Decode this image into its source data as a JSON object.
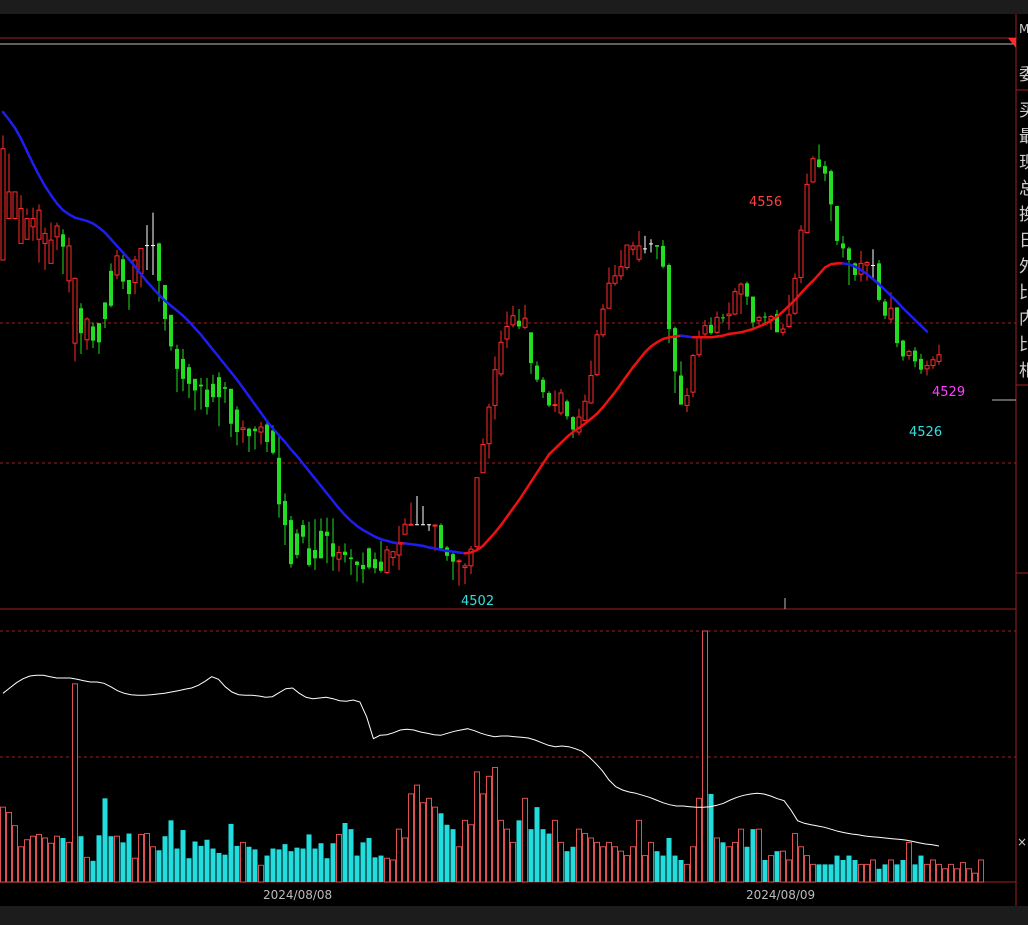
{
  "colors": {
    "background": "#000000",
    "up": "#ff2a2a",
    "down": "#22dd22",
    "flat": "#ffffff",
    "ma_down": "#1e1ef0",
    "ma_up": "#ee1111",
    "vol_up": "#e05050",
    "vol_down": "#22dddd",
    "grid": "#a02020",
    "price_high": "#ff4040",
    "price_low": "#30e0e0",
    "price_last": "#ff40ff"
  },
  "right_panel": {
    "top_marker": "M",
    "labels": [
      "委",
      "买",
      "最",
      "现",
      "总",
      "换",
      "日",
      "外",
      "比",
      "内",
      "比",
      "相"
    ],
    "bottom_marker": "×"
  },
  "chart_data": {
    "type": "candlestick",
    "price_ylim": [
      4498,
      4566
    ],
    "annotations": {
      "high": "4556",
      "low": "4502",
      "last": "4529",
      "last_low": "4526"
    },
    "x_labels": [
      "2024/08/08",
      "2024/08/09"
    ],
    "candles": [
      [
        4540.0,
        4553.4,
        4555.0,
        4541.5
      ],
      [
        4545.0,
        4548.2,
        4552.8,
        4546.7
      ],
      [
        4545.0,
        4548.2,
        4547.3,
        4544.9
      ],
      [
        4542.0,
        4546.2,
        4547.8,
        4543.8
      ],
      [
        4542.5,
        4545.0,
        4546.2,
        4545.4
      ],
      [
        4544.0,
        4545.0,
        4546.3,
        4542.3
      ],
      [
        4542.5,
        4546.0,
        4546.7,
        4539.7
      ],
      [
        4542.0,
        4543.2,
        4543.9,
        4538.8
      ],
      [
        4539.6,
        4542.4,
        4544.5,
        4540.4
      ],
      [
        4542.8,
        4544.1,
        4544.5,
        4541.2
      ],
      [
        4543.1,
        4541.6,
        4543.7,
        4538.3
      ],
      [
        4537.5,
        4541.7,
        4542.7,
        4536.1
      ],
      [
        4530.0,
        4537.8,
        4537.9,
        4527.8
      ],
      [
        4534.2,
        4531.2,
        4534.8,
        4528.7
      ],
      [
        4530.4,
        4532.9,
        4533.1,
        4529.2
      ],
      [
        4532.0,
        4530.3,
        4532.5,
        4529.4
      ],
      [
        4532.4,
        4530.1,
        4532.4,
        4528.7
      ],
      [
        4534.9,
        4532.9,
        4534.9,
        4531.8
      ],
      [
        4538.7,
        4534.5,
        4539.6,
        4534.3
      ],
      [
        4538.2,
        4540.5,
        4541.2,
        4537.7
      ],
      [
        4540.1,
        4537.4,
        4540.6,
        4536.5
      ],
      [
        4537.6,
        4535.9,
        4537.6,
        4534.0
      ],
      [
        4537.3,
        4540.0,
        4540.5,
        4535.9
      ],
      [
        4538.4,
        4541.4,
        4541.4,
        4536.7
      ],
      [
        4541.8,
        4541.8,
        4544.2,
        4538.8
      ],
      [
        4541.8,
        4541.8,
        4545.7,
        4538.2
      ],
      [
        4542.0,
        4537.5,
        4542.1,
        4535.0
      ],
      [
        4537.0,
        4532.9,
        4537.0,
        4531.5
      ],
      [
        4533.4,
        4529.6,
        4533.4,
        4529.1
      ],
      [
        4529.3,
        4526.9,
        4529.8,
        4524.1
      ],
      [
        4528.1,
        4525.7,
        4529.3,
        4524.2
      ],
      [
        4527.1,
        4525.1,
        4527.5,
        4523.4
      ],
      [
        4525.7,
        4524.3,
        4525.7,
        4521.9
      ],
      [
        4525.0,
        4524.8,
        4525.8,
        4522.0
      ],
      [
        4524.4,
        4522.3,
        4525.8,
        4521.4
      ],
      [
        4525.1,
        4523.5,
        4526.2,
        4522.9
      ],
      [
        4525.9,
        4523.5,
        4526.5,
        4520.0
      ],
      [
        4524.7,
        4524.5,
        4525.3,
        4522.8
      ],
      [
        4524.5,
        4520.3,
        4524.5,
        4518.7
      ],
      [
        4522.0,
        4519.3,
        4522.4,
        4517.7
      ],
      [
        4519.6,
        4519.8,
        4520.7,
        4518.0
      ],
      [
        4519.7,
        4518.8,
        4519.8,
        4516.9
      ],
      [
        4519.7,
        4519.4,
        4520.0,
        4517.2
      ],
      [
        4519.3,
        4519.9,
        4520.5,
        4517.8
      ],
      [
        4520.2,
        4518.1,
        4520.6,
        4516.9
      ],
      [
        4519.5,
        4516.8,
        4520.1,
        4516.6
      ],
      [
        4516.2,
        4510.6,
        4519.0,
        4509.0
      ],
      [
        4511.0,
        4508.1,
        4511.9,
        4505.7
      ],
      [
        4508.7,
        4503.4,
        4509.2,
        4503.0
      ],
      [
        4507.1,
        4504.5,
        4507.6,
        4504.1
      ],
      [
        4508.1,
        4506.7,
        4508.7,
        4505.9
      ],
      [
        4505.3,
        4503.3,
        4508.5,
        4503.1
      ],
      [
        4505.1,
        4504.1,
        4508.8,
        4502.7
      ],
      [
        4507.4,
        4504.1,
        4508.9,
        4504.1
      ],
      [
        4507.3,
        4506.8,
        4509.0,
        4503.5
      ],
      [
        4505.9,
        4504.3,
        4508.9,
        4502.6
      ],
      [
        4504.0,
        4504.8,
        4505.6,
        4502.5
      ],
      [
        4504.9,
        4504.5,
        4505.9,
        4503.6
      ],
      [
        4504.2,
        4504.0,
        4505.2,
        4502.1
      ],
      [
        4503.7,
        4503.3,
        4503.8,
        4501.3
      ],
      [
        4503.3,
        4502.8,
        4504.8,
        4501.1
      ],
      [
        4505.3,
        4503.0,
        4505.4,
        4502.8
      ],
      [
        4504.0,
        4502.9,
        4504.8,
        4502.3
      ],
      [
        4503.7,
        4502.6,
        4506.2,
        4502.4
      ],
      [
        4502.4,
        4505.1,
        4505.6,
        4502.2
      ],
      [
        4504.2,
        4504.9,
        4505.0,
        4503.2
      ],
      [
        4504.5,
        4506.0,
        4508.0,
        4502.7
      ],
      [
        4507.0,
        4508.2,
        4508.9,
        4507.0
      ],
      [
        4508.1,
        4508.2,
        4510.8,
        4508.1
      ],
      [
        4508.2,
        4508.2,
        4511.6,
        4508.2
      ],
      [
        4508.2,
        4508.2,
        4510.4,
        4508.1
      ],
      [
        4508.2,
        4508.2,
        4508.2,
        4507.4
      ],
      [
        4508.0,
        4508.1,
        4508.2,
        4505.0
      ],
      [
        4508.1,
        4505.3,
        4508.3,
        4505.3
      ],
      [
        4505.4,
        4504.4,
        4505.6,
        4503.8
      ],
      [
        4504.6,
        4503.7,
        4504.9,
        4501.5
      ],
      [
        4503.7,
        4503.8,
        4504.0,
        4500.8
      ],
      [
        4503.0,
        4503.2,
        4503.5,
        4501.0
      ],
      [
        4503.2,
        4505.2,
        4505.6,
        4502.2
      ],
      [
        4505.5,
        4513.8,
        4513.8,
        4504.9
      ],
      [
        4514.4,
        4517.8,
        4518.5,
        4514.4
      ],
      [
        4517.9,
        4522.3,
        4522.7,
        4516.1
      ],
      [
        4522.5,
        4526.8,
        4528.4,
        4520.8
      ],
      [
        4526.3,
        4530.1,
        4531.5,
        4526.0
      ],
      [
        4530.5,
        4532.0,
        4533.8,
        4529.4
      ],
      [
        4532.2,
        4533.3,
        4534.5,
        4531.9
      ],
      [
        4532.7,
        4532.0,
        4534.1,
        4531.7
      ],
      [
        4531.9,
        4533.0,
        4534.6,
        4531.7
      ],
      [
        4531.3,
        4527.6,
        4531.3,
        4526.3
      ],
      [
        4527.3,
        4525.6,
        4527.8,
        4525.3
      ],
      [
        4525.6,
        4524.1,
        4525.9,
        4523.4
      ],
      [
        4524.0,
        4522.5,
        4524.2,
        4522.3
      ],
      [
        4522.5,
        4522.6,
        4524.3,
        4521.7
      ],
      [
        4521.6,
        4524.0,
        4524.5,
        4521.3
      ],
      [
        4523.0,
        4521.2,
        4523.2,
        4520.8
      ],
      [
        4521.1,
        4519.6,
        4521.2,
        4518.6
      ],
      [
        4519.3,
        4521.1,
        4522.1,
        4518.9
      ],
      [
        4520.7,
        4523.0,
        4523.8,
        4520.6
      ],
      [
        4522.8,
        4526.1,
        4527.9,
        4522.7
      ],
      [
        4526.2,
        4531.0,
        4531.6,
        4526.0
      ],
      [
        4531.0,
        4534.1,
        4534.7,
        4530.7
      ],
      [
        4534.2,
        4537.2,
        4539.1,
        4534.2
      ],
      [
        4537.2,
        4538.1,
        4539.4,
        4536.9
      ],
      [
        4538.1,
        4539.2,
        4541.2,
        4537.6
      ],
      [
        4539.1,
        4541.8,
        4541.8,
        4538.8
      ],
      [
        4541.3,
        4541.7,
        4542.2,
        4540.6
      ],
      [
        4540.1,
        4541.7,
        4543.5,
        4539.8
      ],
      [
        4541.4,
        4541.4,
        4542.9,
        4540.8
      ],
      [
        4542.0,
        4542.0,
        4542.5,
        4540.9
      ],
      [
        4541.8,
        4541.6,
        4541.8,
        4540.1
      ],
      [
        4541.7,
        4539.2,
        4542.4,
        4539.0
      ],
      [
        4539.4,
        4531.7,
        4539.6,
        4530.0
      ],
      [
        4531.8,
        4526.6,
        4532.0,
        4524.0
      ],
      [
        4526.1,
        4522.6,
        4527.8,
        4522.6
      ],
      [
        4522.5,
        4523.7,
        4524.6,
        4521.7
      ],
      [
        4524.1,
        4528.5,
        4528.7,
        4523.5
      ],
      [
        4528.6,
        4530.8,
        4531.5,
        4528.3
      ],
      [
        4531.1,
        4532.1,
        4532.8,
        4530.6
      ],
      [
        4532.2,
        4531.2,
        4533.1,
        4531.0
      ],
      [
        4531.3,
        4533.1,
        4533.8,
        4531.1
      ],
      [
        4533.1,
        4533.0,
        4533.5,
        4532.5
      ],
      [
        4533.3,
        4533.5,
        4534.9,
        4531.6
      ],
      [
        4533.5,
        4536.2,
        4536.6,
        4533.4
      ],
      [
        4535.9,
        4537.1,
        4537.3,
        4533.5
      ],
      [
        4537.2,
        4535.6,
        4537.4,
        4534.6
      ],
      [
        4535.6,
        4532.5,
        4535.6,
        4531.9
      ],
      [
        4532.7,
        4533.1,
        4533.3,
        4532.2
      ],
      [
        4533.2,
        4533.1,
        4533.7,
        4532.3
      ],
      [
        4532.8,
        4533.2,
        4533.4,
        4531.6
      ],
      [
        4533.5,
        4531.3,
        4534.0,
        4531.3
      ],
      [
        4531.3,
        4531.7,
        4532.3,
        4530.9
      ],
      [
        4532.0,
        4533.4,
        4535.8,
        4531.8
      ],
      [
        4533.6,
        4537.8,
        4538.4,
        4533.4
      ],
      [
        4537.9,
        4543.6,
        4544.2,
        4537.2
      ],
      [
        4543.3,
        4549.1,
        4550.4,
        4543.2
      ],
      [
        4549.4,
        4552.2,
        4552.5,
        4549.3
      ],
      [
        4552.1,
        4551.2,
        4553.9,
        4551.1
      ],
      [
        4551.3,
        4550.4,
        4551.9,
        4549.5
      ],
      [
        4550.7,
        4546.7,
        4550.9,
        4544.7
      ],
      [
        4546.5,
        4542.3,
        4546.5,
        4541.8
      ],
      [
        4542.0,
        4541.4,
        4542.9,
        4540.3
      ],
      [
        4541.4,
        4540.0,
        4541.6,
        4537.0
      ],
      [
        4539.6,
        4538.2,
        4539.7,
        4537.5
      ],
      [
        4538.3,
        4539.6,
        4541.1,
        4537.4
      ],
      [
        4539.4,
        4539.7,
        4539.9,
        4537.5
      ],
      [
        4539.4,
        4539.4,
        4541.3,
        4537.6
      ],
      [
        4539.6,
        4535.2,
        4540.0,
        4535.0
      ],
      [
        4535.0,
        4533.3,
        4535.3,
        4532.9
      ],
      [
        4532.9,
        4534.2,
        4536.1,
        4532.4
      ],
      [
        4534.3,
        4530.0,
        4534.3,
        4529.5
      ],
      [
        4530.3,
        4528.4,
        4530.4,
        4527.9
      ],
      [
        4528.5,
        4529.0,
        4529.2,
        4528.0
      ],
      [
        4529.1,
        4527.8,
        4529.5,
        4527.1
      ],
      [
        4528.1,
        4526.8,
        4528.7,
        4526.3
      ],
      [
        4526.9,
        4527.3,
        4527.9,
        4526.1
      ],
      [
        4527.3,
        4528.0,
        4528.4,
        4526.9
      ],
      [
        4527.8,
        4528.6,
        4529.8,
        4527.4
      ]
    ],
    "ma": [
      4557.8,
      4556.9,
      4555.9,
      4554.6,
      4553.1,
      4551.6,
      4550.2,
      4548.9,
      4547.8,
      4546.8,
      4546.0,
      4545.5,
      4545.1,
      4544.9,
      4544.7,
      4544.4,
      4543.9,
      4543.3,
      4542.5,
      4541.7,
      4540.9,
      4540.1,
      4539.2,
      4538.3,
      4537.4,
      4536.6,
      4535.8,
      4535.1,
      4534.5,
      4533.9,
      4533.3,
      4532.6,
      4531.8,
      4531.0,
      4530.1,
      4529.2,
      4528.3,
      4527.4,
      4526.5,
      4525.6,
      4524.6,
      4523.6,
      4522.6,
      4521.6,
      4520.6,
      4519.7,
      4518.9,
      4518.1,
      4517.2,
      4516.4,
      4515.5,
      4514.6,
      4513.7,
      4512.8,
      4511.9,
      4511.0,
      4510.1,
      4509.3,
      4508.6,
      4508.0,
      4507.5,
      4507.1,
      4506.7,
      4506.4,
      4506.2,
      4506.0,
      4505.9,
      4505.9,
      4505.8,
      4505.7,
      4505.6,
      4505.4,
      4505.3,
      4505.1,
      4505.0,
      4504.9,
      4504.8,
      4504.7,
      4504.8,
      4505.1,
      4505.6,
      4506.4,
      4507.2,
      4508.1,
      4509.1,
      4510.1,
      4511.1,
      4512.2,
      4513.3,
      4514.4,
      4515.5,
      4516.6,
      4517.3,
      4518.0,
      4518.7,
      4519.3,
      4519.8,
      4520.3,
      4520.9,
      4521.5,
      4522.3,
      4523.2,
      4524.1,
      4525.1,
      4526.1,
      4527.1,
      4528.0,
      4528.9,
      4529.6,
      4530.1,
      4530.5,
      4530.7,
      4530.8,
      4530.9,
      4530.8,
      4530.7,
      4530.7,
      4530.7,
      4530.7,
      4530.8,
      4530.9,
      4531.1,
      4531.2,
      4531.3,
      4531.5,
      4531.7,
      4532.0,
      4532.3,
      4532.7,
      4533.2,
      4533.8,
      4534.5,
      4535.2,
      4536.0,
      4536.8,
      4537.5,
      4538.3,
      4539.1,
      4539.5,
      4539.6,
      4539.6,
      4539.5,
      4539.2,
      4538.8,
      4538.3,
      4537.7,
      4537.1,
      4536.4,
      4535.7,
      4535.0,
      4534.2,
      4533.5,
      4532.8,
      4532.1,
      4531.4
    ],
    "volume": [
      85,
      79,
      64,
      40,
      48,
      52,
      54,
      50,
      44,
      52,
      50,
      45,
      225,
      52,
      28,
      24,
      53,
      95,
      52,
      52,
      45,
      55,
      27,
      54,
      55,
      40,
      36,
      52,
      70,
      38,
      59,
      27,
      46,
      41,
      48,
      38,
      33,
      31,
      66,
      41,
      45,
      40,
      37,
      19,
      30,
      38,
      37,
      43,
      35,
      39,
      38,
      54,
      38,
      44,
      27,
      44,
      54,
      67,
      60,
      30,
      45,
      50,
      28,
      30,
      27,
      25,
      60,
      50,
      100,
      110,
      90,
      95,
      85,
      78,
      65,
      60,
      40,
      70,
      65,
      125,
      100,
      120,
      130,
      70,
      60,
      45,
      70,
      95,
      60,
      85,
      60,
      55,
      70,
      45,
      35,
      40,
      60,
      55,
      50,
      45,
      40,
      45,
      40,
      35,
      30,
      40,
      70,
      30,
      45,
      35,
      30,
      50,
      30,
      25,
      20,
      40,
      95,
      285,
      100,
      50,
      45,
      40,
      45,
      60,
      40,
      60,
      60,
      25,
      30,
      35,
      35,
      25,
      55,
      40,
      30,
      20,
      20,
      20,
      20,
      30,
      25,
      30,
      25,
      20,
      20,
      25,
      15,
      20,
      25,
      20,
      25,
      45,
      20,
      30,
      20,
      25,
      20,
      15,
      20,
      15,
      22,
      15,
      10,
      25
    ],
    "avg_price_line": [
      4543.0,
      4543.8,
      4544.6,
      4545.2,
      4545.6,
      4545.7,
      4545.7,
      4545.5,
      4545.3,
      4545.3,
      4545.3,
      4545.1,
      4544.9,
      4544.7,
      4544.7,
      4544.5,
      4544.0,
      4543.4,
      4543.0,
      4542.8,
      4542.7,
      4542.7,
      4542.8,
      4542.9,
      4543.0,
      4543.2,
      4543.4,
      4543.6,
      4543.8,
      4544.2,
      4544.8,
      4545.5,
      4545.1,
      4544.0,
      4543.2,
      4542.8,
      4542.7,
      4542.7,
      4542.6,
      4542.4,
      4542.5,
      4543.1,
      4543.7,
      4543.8,
      4543.0,
      4542.4,
      4542.2,
      4542.3,
      4542.4,
      4542.2,
      4541.9,
      4541.8,
      4542.0,
      4541.7,
      4539.5,
      4536.2,
      4536.7,
      4536.8,
      4537.1,
      4537.5,
      4537.6,
      4537.5,
      4537.2,
      4537.0,
      4536.8,
      4536.7,
      4537.0,
      4537.3,
      4537.5,
      4537.7,
      4537.4,
      4537.0,
      4536.7,
      4536.5,
      4536.6,
      4536.6,
      4536.5,
      4536.4,
      4536.3,
      4536.0,
      4535.6,
      4535.2,
      4535.0,
      4535.1,
      4535.0,
      4534.7,
      4534.3,
      4533.5,
      4532.5,
      4531.4,
      4530.0,
      4529.0,
      4528.5,
      4528.2,
      4528.0,
      4527.7,
      4527.4,
      4527.0,
      4526.6,
      4526.3,
      4526.1,
      4526.1,
      4526.0,
      4525.9,
      4525.9,
      4526.0,
      4526.2,
      4526.5,
      4527.0,
      4527.4,
      4527.7,
      4527.9,
      4528.0,
      4527.9,
      4527.6,
      4527.2,
      4526.9,
      4525.5,
      4523.9,
      4523.5,
      4523.3,
      4523.1,
      4522.9,
      4522.6,
      4522.3,
      4522.1,
      4521.9,
      4521.8,
      4521.6,
      4521.5,
      4521.4,
      4521.3,
      4521.2,
      4521.1,
      4521.0,
      4520.8,
      4520.6,
      4520.4,
      4520.3,
      4520.1
    ],
    "avg_price_ylim": [
      4515,
      4551
    ]
  }
}
